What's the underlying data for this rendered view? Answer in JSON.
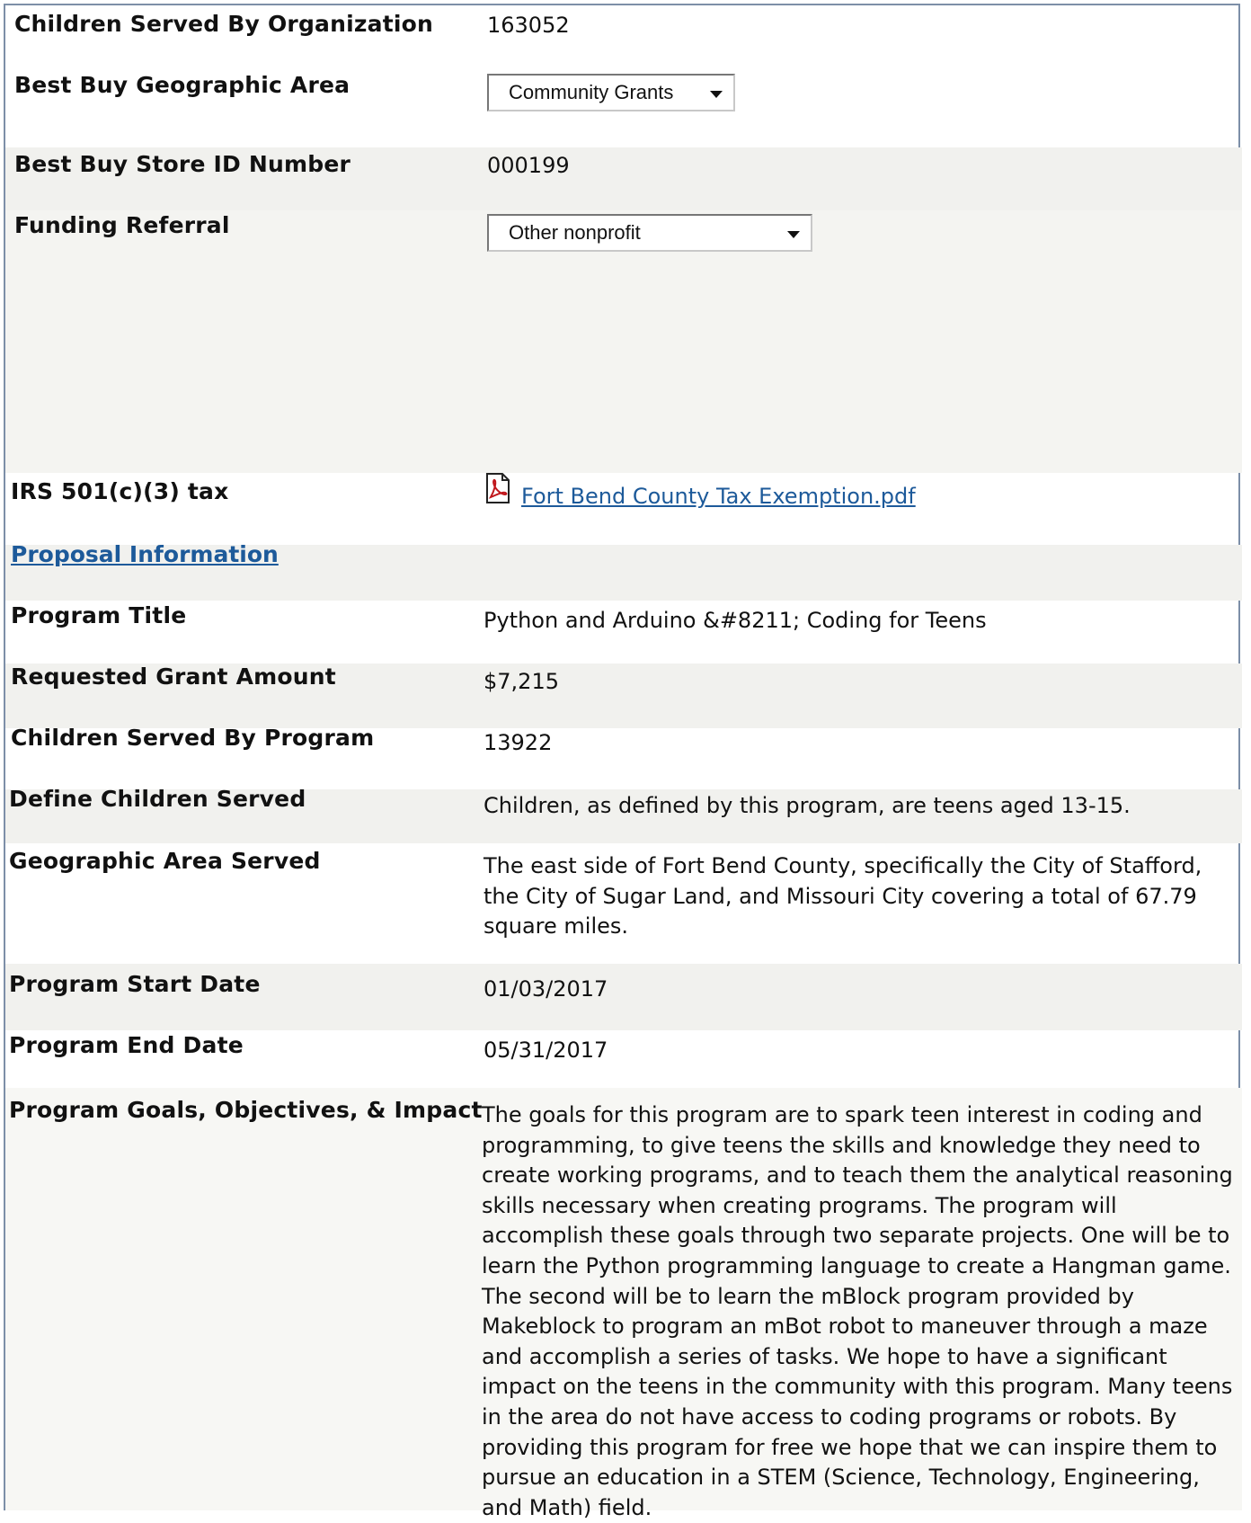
{
  "org": {
    "children_served_label": "Children Served By Organization",
    "children_served_value": "163052",
    "geo_area_label": "Best Buy Geographic Area",
    "geo_area_selected": "Community Grants",
    "store_id_label": "Best Buy Store ID Number",
    "store_id_value": "000199",
    "funding_referral_label": "Funding Referral",
    "funding_referral_selected": "Other nonprofit",
    "irs_label": "IRS 501(c)(3) tax",
    "irs_file_link": "Fort Bend County Tax Exemption.pdf",
    "irs_file_icon": "pdf-icon"
  },
  "proposal": {
    "section_title": "Proposal Information",
    "program_title_label": "Program Title",
    "program_title_value": "Python and Arduino &#8211; Coding for Teens",
    "grant_amount_label": "Requested Grant Amount",
    "grant_amount_value": "$7,215",
    "children_program_label": "Children Served By Program",
    "children_program_value": "13922",
    "define_children_label": "Define Children Served",
    "define_children_value": "Children, as defined by this program, are teens aged 13-15.",
    "geo_served_label": "Geographic Area Served",
    "geo_served_value": "The east side of Fort Bend County, specifically the City of Stafford, the City of Sugar Land, and Missouri City covering a total of 67.79 square miles.",
    "start_date_label": "Program Start Date",
    "start_date_value": "01/03/2017",
    "end_date_label": "Program End Date",
    "end_date_value": "05/31/2017",
    "goals_label": "Program Goals, Objectives, & Impact",
    "goals_value": "The goals for this program are to spark teen interest in coding and programming, to give teens the skills and knowledge they need to create working programs, and to teach them the analytical reasoning skills necessary when creating programs. The program will accomplish these goals through two separate projects. One will be to learn the Python programming language to create a Hangman game. The second will be to learn the mBlock program provided by Makeblock to program an mBot robot to maneuver through a maze and accomplish a series of tasks. We hope to have a significant impact on the teens in the community with this program. Many teens in the area do not have access to coding programs or robots. By providing this program for free we hope that we can inspire them to pursue an education in a STEM (Science, Technology, Engineering, and Math) field."
  }
}
